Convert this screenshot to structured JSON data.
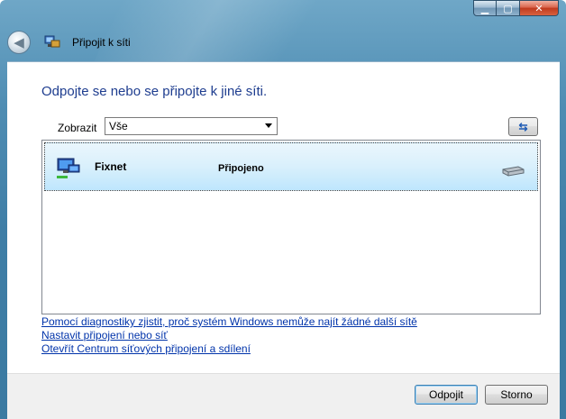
{
  "window": {
    "title": "Připojit k síti",
    "caption_buttons": {
      "minimize_icon": "minimize-icon",
      "maximize_icon": "maximize-icon",
      "close_icon": "close-icon"
    }
  },
  "main": {
    "heading": "Odpojte se nebo se připojte k jiné síti.",
    "filter": {
      "label": "Zobrazit",
      "selected": "Vše"
    },
    "networks": [
      {
        "name": "Fixnet",
        "status": "Připojeno",
        "icon": "network-computer-icon",
        "signal_icon": "wired-connection-icon"
      }
    ],
    "links": [
      "Pomocí diagnostiky zjistit, proč systém Windows nemůže najít žádné další sítě",
      "Nastavit připojení nebo síť",
      "Otevřít Centrum síťových připojení a sdílení"
    ]
  },
  "footer": {
    "connect_label": "Odpojit",
    "cancel_label": "Storno"
  },
  "colors": {
    "heading": "#1e3d8f",
    "link": "#0033aa",
    "selected_row": "#d9f0fc"
  }
}
